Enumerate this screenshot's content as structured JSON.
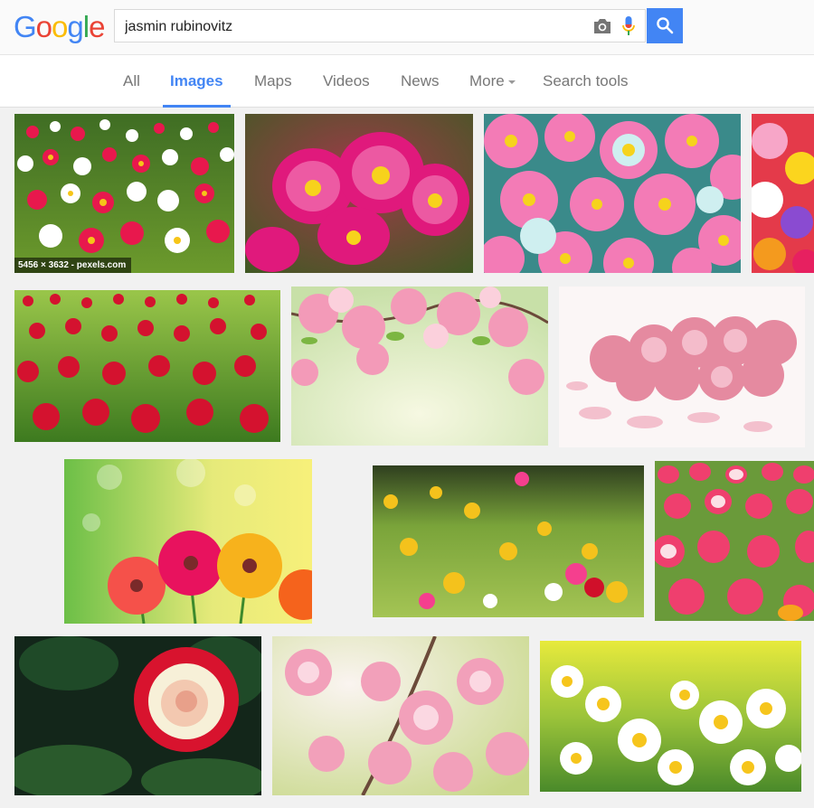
{
  "logo": {
    "letters": [
      "G",
      "o",
      "o",
      "g",
      "l",
      "e"
    ],
    "colors": [
      "#4285f4",
      "#ea4335",
      "#fbbc05",
      "#4285f4",
      "#34a853",
      "#ea4335"
    ]
  },
  "search": {
    "query": "jasmin rubinovitz"
  },
  "icons": {
    "camera": "camera-icon",
    "mic": "mic-icon",
    "search": "search-icon"
  },
  "tabs": [
    {
      "label": "All",
      "active": false
    },
    {
      "label": "Images",
      "active": true
    },
    {
      "label": "Maps",
      "active": false
    },
    {
      "label": "Videos",
      "active": false
    },
    {
      "label": "News",
      "active": false
    },
    {
      "label": "More",
      "active": false
    },
    {
      "label": "Search tools",
      "active": false
    }
  ],
  "results": [
    {
      "subject": "red and white daisies in field",
      "caption": "5456 × 3632 - pexels.com"
    },
    {
      "subject": "pink chrysanthemums"
    },
    {
      "subject": "pink and white wild roses"
    },
    {
      "subject": "mixed colorful flowers"
    },
    {
      "subject": "red daisy field"
    },
    {
      "subject": "pink blossom branches"
    },
    {
      "subject": "pink roses bouquet"
    },
    {
      "subject": "gerbera daisies with bokeh"
    },
    {
      "subject": "wildflower meadow"
    },
    {
      "subject": "pink and red tulips"
    },
    {
      "subject": "red and white rose"
    },
    {
      "subject": "pink cherry blossoms"
    },
    {
      "subject": "white daisies in sunlight"
    }
  ],
  "colors": {
    "accent": "#4285f4",
    "background": "#f1f1f1"
  }
}
